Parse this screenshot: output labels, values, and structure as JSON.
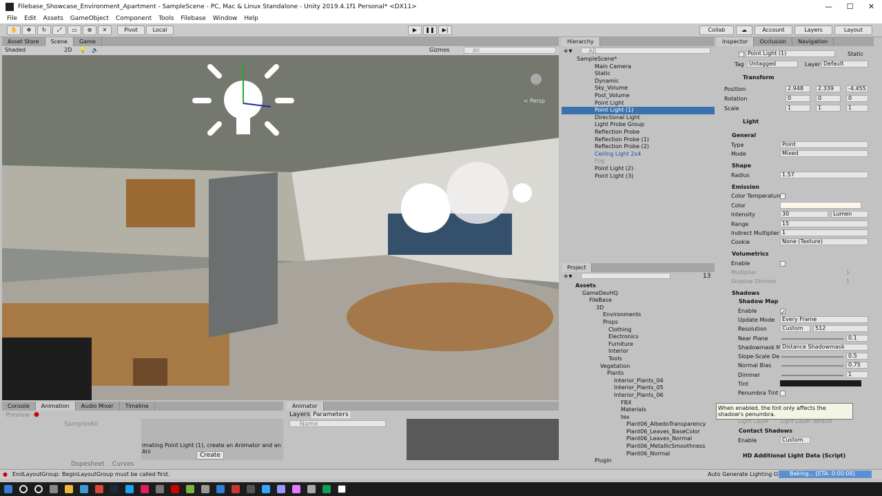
{
  "window": {
    "title": "Filebase_Showcase_Environment_Apartment - SampleScene - PC, Mac & Linux Standalone - Unity 2019.4.1f1 Personal* <DX11>",
    "min": "—",
    "max": "☐",
    "close": "✕"
  },
  "menu": [
    "File",
    "Edit",
    "Assets",
    "GameObject",
    "Component",
    "Tools",
    "Filebase",
    "Window",
    "Help"
  ],
  "toolbar": {
    "pivot": "Pivot",
    "local": "Local",
    "collab": "Collab",
    "account": "Account",
    "layers": "Layers",
    "layout": "Layout"
  },
  "scene_tabs": [
    "Asset Store",
    "Scene",
    "Game"
  ],
  "scene_bar": {
    "shading": "Shaded",
    "mode2d": "2D",
    "gizmos": "Gizmos",
    "search": "All",
    "persp": "< Persp"
  },
  "hierarchy": {
    "tab": "Hierarchy",
    "search": "All",
    "root": "SampleScene*",
    "items": [
      "Main Camera",
      "Static",
      "Dynamic",
      "Sky_Volume",
      "Post_Volume",
      "Point Light",
      "Point Light (1)",
      "Directional Light",
      "Light Probe Group",
      "Reflection Probe",
      "Reflection Probe (1)",
      "Reflection Probe (2)",
      "Ceiling Light 2x4",
      "Fog",
      "Point Light (2)",
      "Point Light (3)"
    ]
  },
  "project": {
    "tab": "Project",
    "count": "13",
    "tree": [
      "Assets",
      "GameDevHQ",
      "FileBase",
      "3D",
      "Environments",
      "Props",
      "Clothing",
      "Electronics",
      "Furniture",
      "Interior",
      "Tools",
      "Vegetation",
      "Plants",
      "Interior_Plants_04",
      "Interior_Plants_05",
      "Interior_Plants_06",
      "FBX",
      "Materials",
      "tex",
      "Plant06_AlbedoTransparency",
      "Plant06_Leaves_BaseColor",
      "Plant06_Leaves_Normal",
      "Plant06_MetallicSmoothness",
      "Plant06_Normal",
      "Plugin"
    ]
  },
  "inspector": {
    "tabs": [
      "Inspector",
      "Occlusion",
      "Navigation"
    ],
    "object_name": "Point Light (1)",
    "static": "Static",
    "tag_label": "Tag",
    "tag": "Untagged",
    "layer_label": "Layer",
    "layer": "Default",
    "transform": {
      "title": "Transform",
      "position_label": "Position",
      "rotation_label": "Rotation",
      "scale_label": "Scale",
      "px": "2.948",
      "py": "2.339",
      "pz": "-4.455",
      "rx": "0",
      "ry": "0",
      "rz": "0",
      "sx": "1",
      "sy": "1",
      "sz": "1"
    },
    "light": {
      "title": "Light",
      "general": "General",
      "type_label": "Type",
      "type": "Point",
      "mode_label": "Mode",
      "mode": "Mixed",
      "shape": "Shape",
      "radius_label": "Radius",
      "radius": "1.57",
      "emission": "Emission",
      "colortemp_label": "Color Temperature",
      "color_label": "Color",
      "intensity_label": "Intensity",
      "intensity": "30",
      "unit": "Lumen",
      "range_label": "Range",
      "range": "15",
      "indirect_label": "Indirect Multiplier",
      "indirect": "1",
      "cookie_label": "Cookie",
      "cookie": "None (Texture)",
      "volumetrics": "Volumetrics",
      "enable_label": "Enable",
      "multiplier_label": "Multiplier",
      "multiplier": "1",
      "shadow_dimmer_label": "Shadow Dimmer",
      "shadow_dimmer": "1"
    },
    "shadows": {
      "title": "Shadows",
      "shadow_map": "Shadow Map",
      "enable_label": "Enable",
      "update_label": "Update Mode",
      "update": "Every Frame",
      "resolution_label": "Resolution",
      "resolution": "Custom",
      "resolution_value": "512",
      "near_label": "Near Plane",
      "near": "0.1",
      "shadowmask_label": "Shadowmask M",
      "shadowmask": "Distance Shadowmask",
      "slope_label": "Slope-Scale De",
      "slope": "0.5",
      "normal_label": "Normal Bias",
      "normal": "0.75",
      "dimmer_label": "Dimmer",
      "dimmer": "1",
      "tint_label": "Tint",
      "penumbra_label": "Penumbra Tint",
      "tooltip": "When enabled, the tint only affects the shadow's penumbra.",
      "light_layer": "Light Layer",
      "light_layer_value": "Light Layer default",
      "contact": "Contact Shadows",
      "contact_enable": "Enable",
      "contact_value": "Custom"
    },
    "hd": "HD Additional Light Data (Script)"
  },
  "bottom": {
    "tabs": [
      "Console",
      "Animation",
      "Audio Mixer",
      "Timeline"
    ],
    "preview": "Preview",
    "samples_label": "Samples",
    "samples": "60",
    "msg": "imating Point Light (1), create an Animator and an Ani",
    "create": "Create",
    "dopesheet": "Dopesheet",
    "curves": "Curves"
  },
  "animator": {
    "tab": "Animator",
    "layers": "Layers",
    "parameters": "Parameters",
    "name_hdr": "Name"
  },
  "status": {
    "error": "EndLayoutGroup: BeginLayoutGroup must be called first.",
    "auto": "Auto Generate Lighting On",
    "baking": "Baking... [ETA: 0:00:08]"
  }
}
